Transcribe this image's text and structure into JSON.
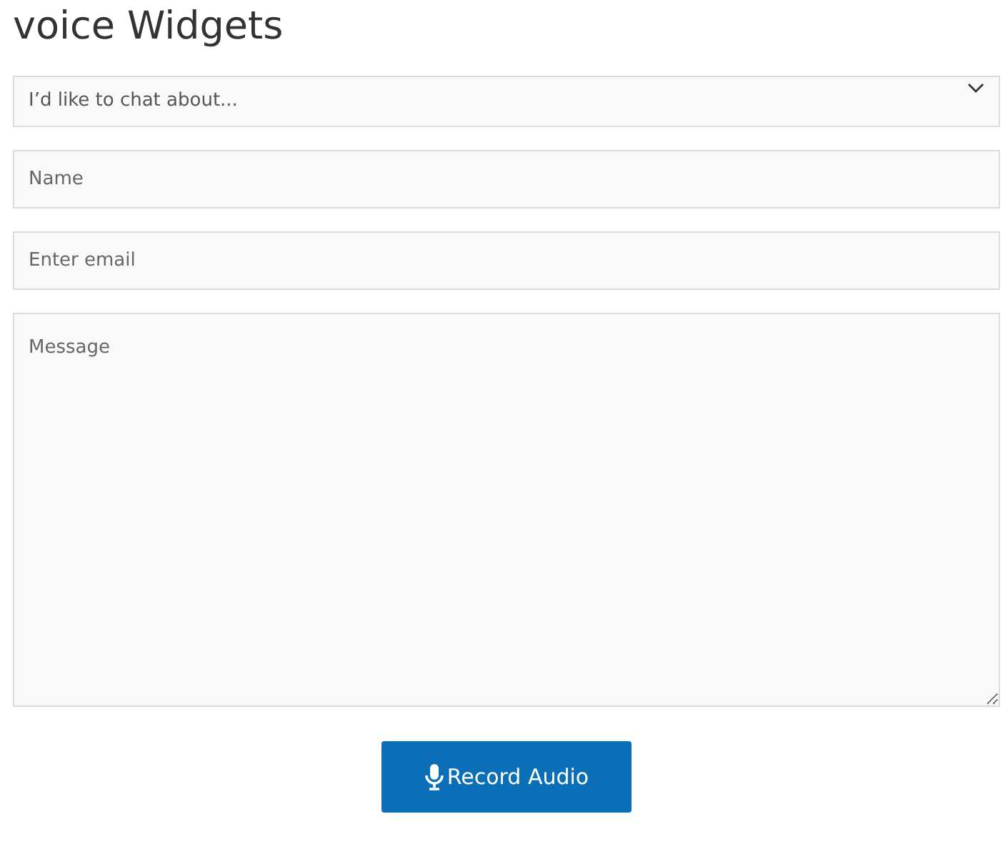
{
  "title": "voice Widgets",
  "topic_select": {
    "placeholder": "I’d like to chat about..."
  },
  "fields": [
    {
      "kind": "input",
      "placeholder": "Name"
    },
    {
      "kind": "input",
      "placeholder": "Enter email"
    },
    {
      "kind": "textarea",
      "placeholder": "Message"
    }
  ],
  "record_button": {
    "label": "Record Audio"
  }
}
